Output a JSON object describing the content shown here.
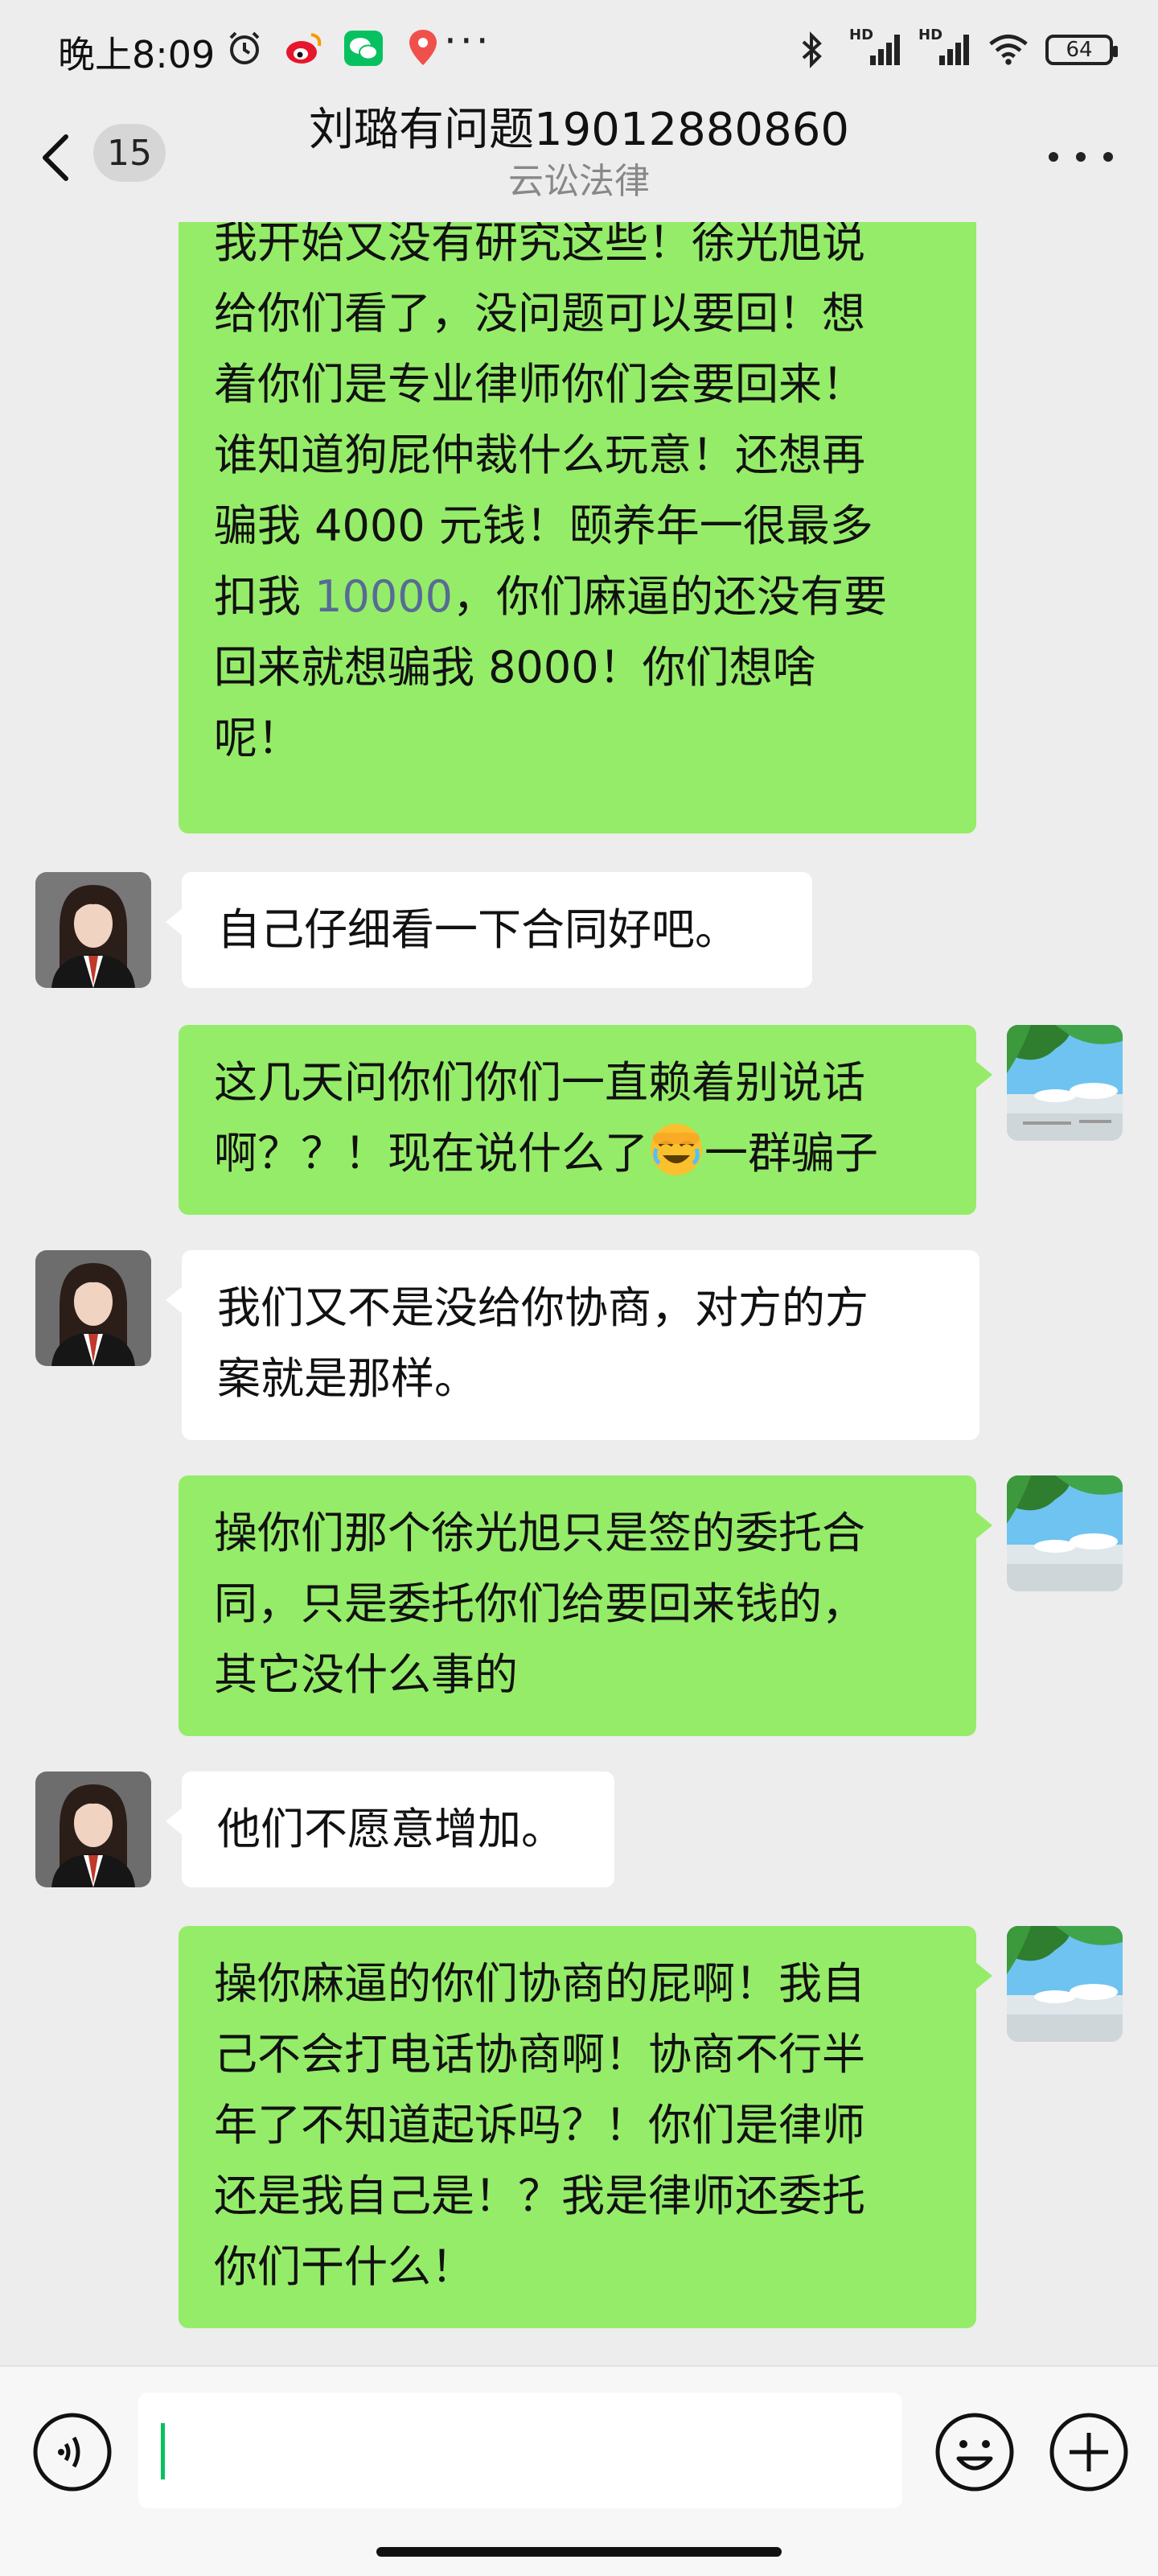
{
  "status_bar": {
    "time": "晚上8:09",
    "battery": "64",
    "signal_label_1": "HD",
    "signal_label_2": "HD",
    "more": "···"
  },
  "header": {
    "unread_count": "15",
    "title": "刘璐有问题19012880860",
    "subtitle": "云讼法律"
  },
  "messages": [
    {
      "sender": "me",
      "lines": [
        "我开始又没有研究这些！徐光旭说",
        "给你们看了，没问题可以要回！想",
        "着你们是专业律师你们会要回来！",
        "谁知道狗屁仲裁什么玩意！还想再",
        "骗我 4000 元钱！颐养年一很最多",
        "扣我 ",
        "10000",
        "，你们麻逼的还没有要",
        "回来就想骗我 8000！你们想啥",
        "呢！"
      ]
    },
    {
      "sender": "them",
      "text": "自己仔细看一下合同好吧。"
    },
    {
      "sender": "me",
      "line1": "这几天问你们你们一直赖着别说话",
      "line2_a": "啊？？！现在说什么了",
      "line2_b": "一群骗子",
      "emoji": "facepalm-laughing"
    },
    {
      "sender": "them",
      "line1": "我们又不是没给你协商，对方的方",
      "line2": "案就是那样。"
    },
    {
      "sender": "me",
      "line1": "操你们那个徐光旭只是签的委托合",
      "line2": "同，只是委托你们给要回来钱的，",
      "line3": "其它没什么事的"
    },
    {
      "sender": "them",
      "text": "他们不愿意增加。"
    },
    {
      "sender": "me",
      "line1": "操你麻逼的你们协商的屁啊！我自",
      "line2": "己不会打电话协商啊！协商不行半",
      "line3": "年了不知道起诉吗？！你们是律师",
      "line4": "还是我自己是！？我是律师还委托",
      "line5": "你们干什么！"
    }
  ],
  "input": {
    "value": ""
  },
  "colors": {
    "my_bubble": "#95ec69",
    "their_bubble": "#ffffff",
    "background": "#ededed",
    "link_number": "#576b95"
  }
}
